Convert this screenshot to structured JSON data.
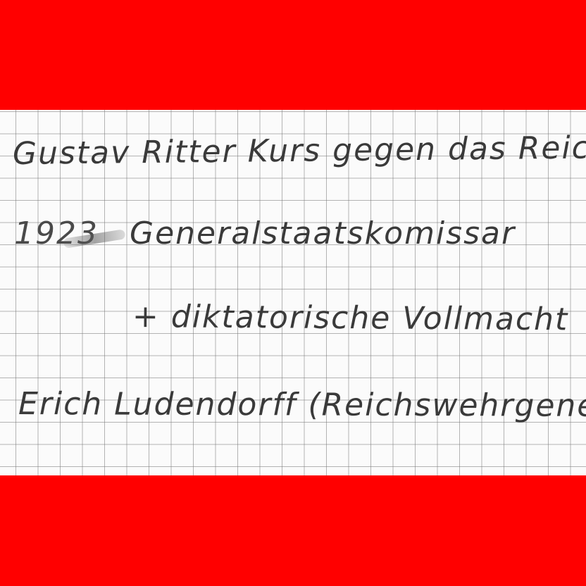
{
  "note": {
    "line1": "Gustav Ritter Kurs gegen das Reich",
    "line2_year": "1923",
    "line2_text": "Generalstaatskomissar",
    "line3": "+ diktatorische Vollmacht",
    "line4": "Erich Ludendorff (Reichswehrgenerdl"
  },
  "colors": {
    "band": "#ff0000",
    "paper": "#fbfbfb",
    "ink": "#3a3a3a",
    "grid": "#787878"
  }
}
